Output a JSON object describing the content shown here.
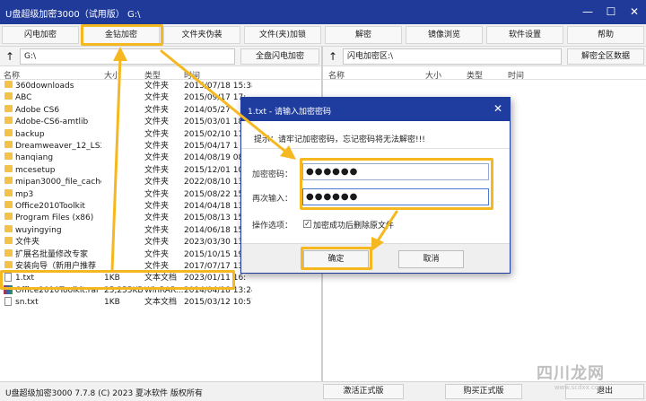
{
  "window": {
    "title": "U盘超级加密3000（试用版）  G:\\",
    "minimize_glyph": "—",
    "maximize_glyph": "☐",
    "close_glyph": "✕"
  },
  "toolbar": {
    "items": [
      "闪电加密",
      "金钻加密",
      "文件夹伪装",
      "文件(夹)加锁",
      "解密",
      "镜像浏览",
      "软件设置",
      "帮助"
    ]
  },
  "left_path": {
    "up_glyph": "↑",
    "value": "G:\\",
    "button": "全盘闪电加密"
  },
  "right_path": {
    "up_glyph": "↑",
    "value": "闪电加密区:\\",
    "button": "解密全区数据"
  },
  "left_columns": [
    "名称",
    "大小",
    "类型",
    "时间"
  ],
  "right_columns": [
    "名称",
    "大小",
    "类型",
    "时间"
  ],
  "files": [
    {
      "name": "360downloads",
      "size": "",
      "type": "文件夹",
      "time": "2015/07/18 15:38",
      "icon": "folder-icon"
    },
    {
      "name": "ABC",
      "size": "",
      "type": "文件夹",
      "time": "2015/09/17 17:",
      "icon": "folder-icon"
    },
    {
      "name": "Adobe CS6",
      "size": "",
      "type": "文件夹",
      "time": "2014/05/27",
      "icon": "folder-icon"
    },
    {
      "name": "Adobe-CS6-amtlib",
      "size": "",
      "type": "文件夹",
      "time": "2015/03/01 18:",
      "icon": "folder-icon"
    },
    {
      "name": "backup",
      "size": "",
      "type": "文件夹",
      "time": "2015/02/10 11:",
      "icon": "folder-icon"
    },
    {
      "name": "Dreamweaver_12_LS3",
      "size": "",
      "type": "文件夹",
      "time": "2015/04/17 1",
      "icon": "folder-icon"
    },
    {
      "name": "hanqiang",
      "size": "",
      "type": "文件夹",
      "time": "2014/08/19 08:",
      "icon": "folder-icon"
    },
    {
      "name": "mcesetup",
      "size": "",
      "type": "文件夹",
      "time": "2015/12/01 10:",
      "icon": "folder-icon"
    },
    {
      "name": "mipan3000_file_cache",
      "size": "",
      "type": "文件夹",
      "time": "2022/08/10 13:",
      "icon": "folder-icon"
    },
    {
      "name": "mp3",
      "size": "",
      "type": "文件夹",
      "time": "2015/08/22 15:",
      "icon": "folder-icon"
    },
    {
      "name": "Office2010Toolkit",
      "size": "",
      "type": "文件夹",
      "time": "2014/04/18 13:",
      "icon": "folder-icon"
    },
    {
      "name": "Program Files (x86)",
      "size": "",
      "type": "文件夹",
      "time": "2015/08/13 15:",
      "icon": "folder-icon"
    },
    {
      "name": "wuyingying",
      "size": "",
      "type": "文件夹",
      "time": "2014/06/18 15:",
      "icon": "folder-icon"
    },
    {
      "name": "文件夹",
      "size": "",
      "type": "文件夹",
      "time": "2023/03/30 13:",
      "icon": "folder-icon"
    },
    {
      "name": "扩展名批量修改专家",
      "size": "",
      "type": "文件夹",
      "time": "2015/10/15 19:",
      "icon": "folder-icon"
    },
    {
      "name": "安装向导（新用户推荐",
      "size": "",
      "type": "文件夹",
      "time": "2017/07/17 13:",
      "icon": "folder-icon"
    },
    {
      "name": "1.txt",
      "size": "1KB",
      "type": "文本文档",
      "time": "2023/01/11 16:",
      "icon": "text-file-icon"
    },
    {
      "name": "Office2010Toolkit.rar",
      "size": "25,255KB",
      "type": "WinRAR...",
      "time": "2014/04/18 13:24",
      "icon": "rar-file-icon"
    },
    {
      "name": "sn.txt",
      "size": "1KB",
      "type": "文本文档",
      "time": "2015/03/12 10:57",
      "icon": "text-file-icon"
    }
  ],
  "status": {
    "text": "U盘超级加密3000 7.7.8 (C) 2023 夏冰软件 版权所有",
    "activate_button": "激活正式版",
    "buy_button": "购买正式版",
    "exit_button": "退出"
  },
  "dialog": {
    "title": "1.txt - 请输入加密密码",
    "close_glyph": "✕",
    "warning": "提示：请牢记加密密码，忘记密码将无法解密!!!",
    "password_label": "加密密码：",
    "password_value": "●●●●●●",
    "confirm_label": "再次输入：",
    "confirm_value": "●●●●●●",
    "options_label": "操作选项：",
    "checkbox_glyph": "✓",
    "checkbox_checked": true,
    "checkbox_label": "加密成功后删除原文件",
    "ok_button": "确定",
    "cancel_button": "取消"
  },
  "watermark": {
    "text": "四川龙网",
    "subtext": "www.scdxx.com"
  },
  "colors": {
    "title_bar": "#203a9a",
    "highlight": "#f5b820",
    "folder": "#f3c24a"
  }
}
